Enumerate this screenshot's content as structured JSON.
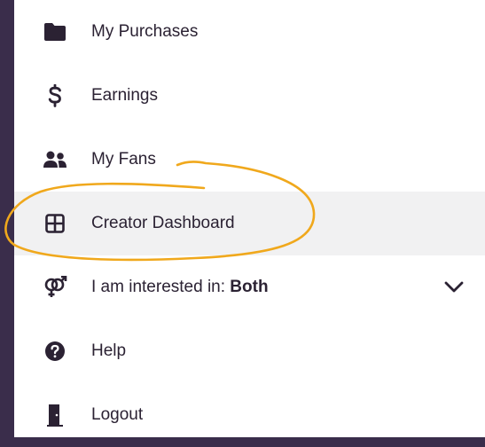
{
  "menu": {
    "items": [
      {
        "id": "my-purchases",
        "label": "My Purchases",
        "icon": "folder-icon"
      },
      {
        "id": "earnings",
        "label": "Earnings",
        "icon": "dollar-icon"
      },
      {
        "id": "my-fans",
        "label": "My Fans",
        "icon": "users-icon"
      },
      {
        "id": "creator-dashboard",
        "label": "Creator Dashboard",
        "icon": "grid-icon",
        "active": true
      },
      {
        "id": "interested-in",
        "label_prefix": "I am interested in: ",
        "label_value": "Both",
        "icon": "gender-icon",
        "has_dropdown": true
      },
      {
        "id": "help",
        "label": "Help",
        "icon": "help-circle-icon"
      },
      {
        "id": "logout",
        "label": "Logout",
        "icon": "door-icon"
      }
    ]
  },
  "colors": {
    "background": "#3a2d4b",
    "panel": "#ffffff",
    "active_row": "#f1f1f2",
    "icon": "#2b2233",
    "annotation": "#f0a81c"
  }
}
